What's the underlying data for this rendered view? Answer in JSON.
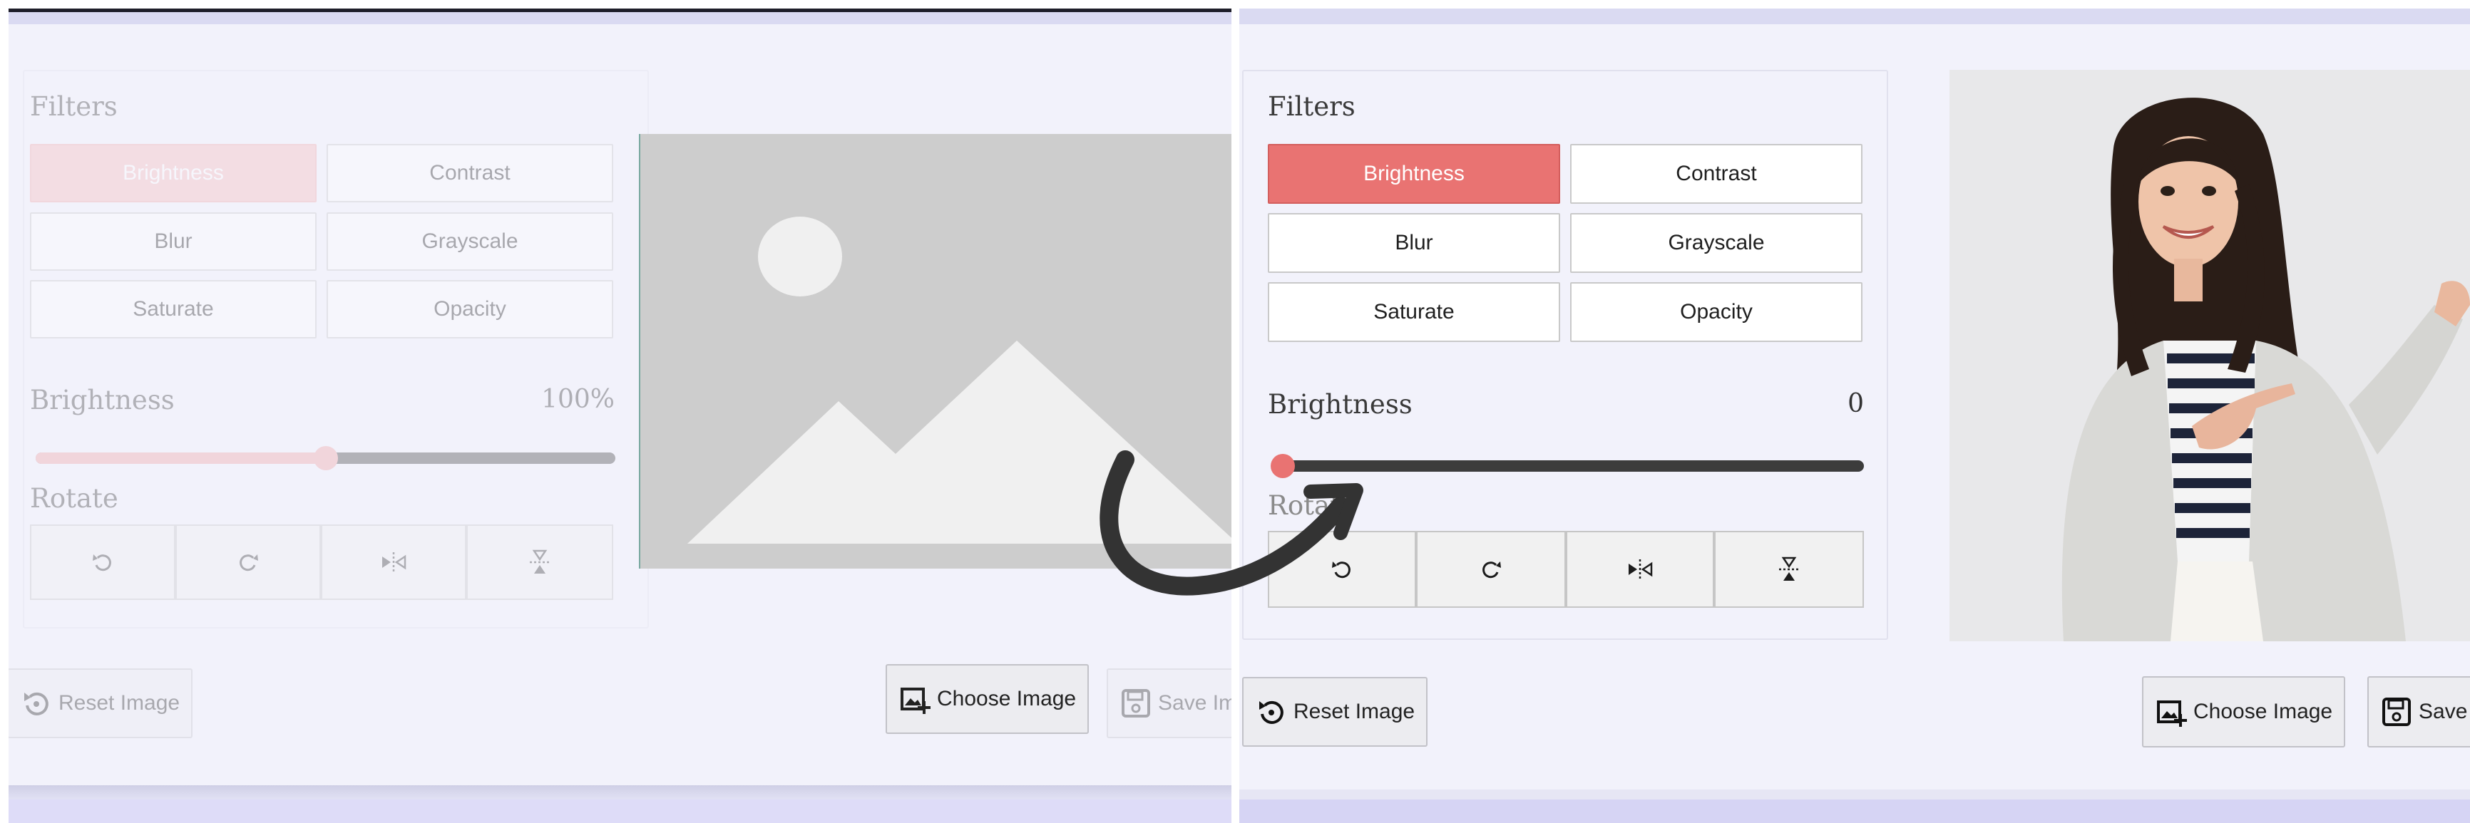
{
  "left_panel": {
    "filters_title": "Filters",
    "filters": [
      {
        "label": "Brightness",
        "active": true
      },
      {
        "label": "Contrast",
        "active": false
      },
      {
        "label": "Blur",
        "active": false
      },
      {
        "label": "Grayscale",
        "active": false
      },
      {
        "label": "Saturate",
        "active": false
      },
      {
        "label": "Opacity",
        "active": false
      }
    ],
    "slider_label": "Brightness",
    "slider_value_text": "100%",
    "slider_fraction": 0.5,
    "rotate_title": "Rotate",
    "rotate_buttons": [
      "rotate-left-icon",
      "rotate-right-icon",
      "flip-horizontal-icon",
      "flip-vertical-icon"
    ],
    "reset_label": "Reset Image",
    "choose_label": "Choose Image",
    "save_label": "Save Im"
  },
  "right_panel": {
    "filters_title": "Filters",
    "filters": [
      {
        "label": "Brightness",
        "active": true
      },
      {
        "label": "Contrast",
        "active": false
      },
      {
        "label": "Blur",
        "active": false
      },
      {
        "label": "Grayscale",
        "active": false
      },
      {
        "label": "Saturate",
        "active": false
      },
      {
        "label": "Opacity",
        "active": false
      }
    ],
    "slider_label": "Brightness",
    "slider_value_text": "0",
    "slider_fraction": 0,
    "rotate_title": "Rotate",
    "rotate_buttons": [
      "rotate-left-icon",
      "rotate-right-icon",
      "flip-horizontal-icon",
      "flip-vertical-icon"
    ],
    "reset_label": "Reset Image",
    "choose_label": "Choose Image",
    "save_label": "Save"
  },
  "colors": {
    "accent": "#e97372",
    "background": "#f2f2fb",
    "track": "#3c3c3c"
  }
}
